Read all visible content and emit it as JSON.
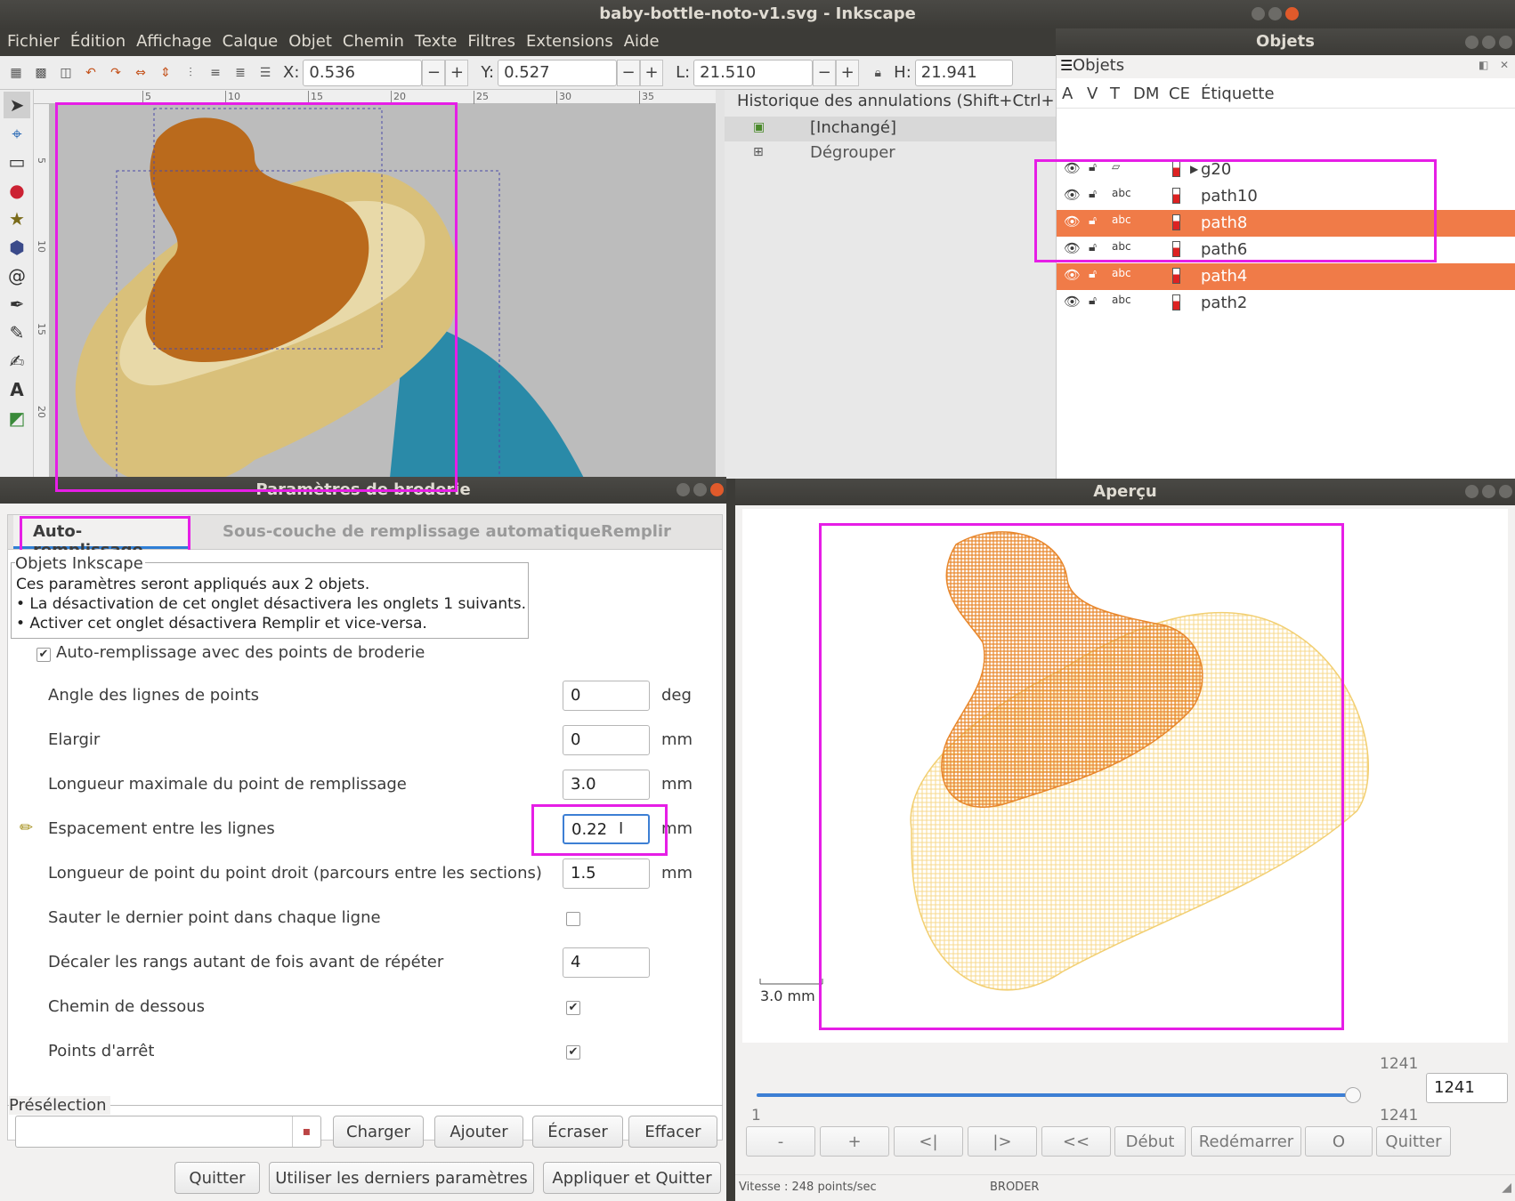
{
  "main_window": {
    "title": "baby-bottle-noto-v1.svg - Inkscape",
    "menu": [
      "Fichier",
      "Édition",
      "Affichage",
      "Calque",
      "Objet",
      "Chemin",
      "Texte",
      "Filtres",
      "Extensions",
      "Aide"
    ],
    "toolbar": {
      "x_label": "X:",
      "x_value": "0.536",
      "y_label": "Y:",
      "y_value": "0.527",
      "w_label": "L:",
      "w_value": "21.510",
      "h_label": "H:",
      "h_value": "21.941",
      "minus": "−",
      "plus": "+"
    },
    "ruler_ticks": [
      "5",
      "10",
      "15",
      "20",
      "25",
      "30",
      "35"
    ],
    "vruler_ticks": [
      "5",
      "10",
      "15",
      "20"
    ],
    "history": {
      "title": "Historique des annulations (Shift+Ctrl+",
      "items": [
        "[Inchangé]",
        "Dégrouper"
      ]
    }
  },
  "objects_window": {
    "title": "Objets",
    "panel_title": "Objets",
    "columns": [
      "A",
      "V",
      "T",
      "DM",
      "CE",
      "Étiquette"
    ],
    "rows": [
      {
        "label": "g20",
        "selected": false
      },
      {
        "label": "path10",
        "selected": false
      },
      {
        "label": "path8",
        "selected": true
      },
      {
        "label": "path6",
        "selected": false
      },
      {
        "label": "path4",
        "selected": true
      },
      {
        "label": "path2",
        "selected": false
      }
    ]
  },
  "embroidery_dialog": {
    "title": "Paramètres de broderie",
    "tabs": [
      "Auto-remplissage",
      "Sous-couche de remplissage automatique",
      "Remplir"
    ],
    "group_title": "Objets Inkscape",
    "info_lines": [
      "Ces paramètres seront appliqués aux 2 objets.",
      "• La désactivation de cet onglet désactivera les onglets 1 suivants.",
      "• Activer cet onglet désactivera Remplir et vice-versa."
    ],
    "enable_label": "Auto-remplissage avec des points de broderie",
    "params": [
      {
        "label": "Angle des lignes de points",
        "value": "0",
        "unit": "deg"
      },
      {
        "label": "Elargir",
        "value": "0",
        "unit": "mm"
      },
      {
        "label": "Longueur maximale du point de remplissage",
        "value": "3.0",
        "unit": "mm"
      },
      {
        "label": "Espacement entre les lignes",
        "value": "0.22",
        "unit": "mm"
      },
      {
        "label": "Longueur de point du point droit (parcours entre les sections)",
        "value": "1.5",
        "unit": "mm"
      },
      {
        "label": "Sauter le dernier point dans chaque ligne",
        "checked": false
      },
      {
        "label": "Décaler les rangs autant de fois avant de répéter",
        "value": "4"
      },
      {
        "label": "Chemin de dessous",
        "checked": true
      },
      {
        "label": "Points d'arrêt",
        "checked": true
      }
    ],
    "preset_title": "Présélection",
    "preset_buttons": [
      "Charger",
      "Ajouter",
      "Écraser",
      "Effacer"
    ],
    "footer_buttons": [
      "Quitter",
      "Utiliser les derniers paramètres",
      "Appliquer et Quitter"
    ]
  },
  "preview_window": {
    "title": "Aperçu",
    "scale_label": "3.0 mm",
    "slider": {
      "min": "1",
      "max": "1241",
      "top": "1241",
      "value": "1241",
      "fraction": 1.0
    },
    "buttons": [
      "-",
      "+",
      "<|",
      "|>",
      "<<",
      "Début",
      "Redémarrer",
      "O",
      "Quitter"
    ],
    "status_speed": "Vitesse : 248 points/sec",
    "status_mode": "BRODER"
  },
  "colors": {
    "selection": "#f07b48",
    "highlight": "#e61ee6",
    "orange_fill": "#ba6a1c",
    "tan_fill": "#d9c07a",
    "teal_fill": "#2a8aa8",
    "stitch_orange": "#e8872c",
    "stitch_yellow": "#f7d98c"
  }
}
